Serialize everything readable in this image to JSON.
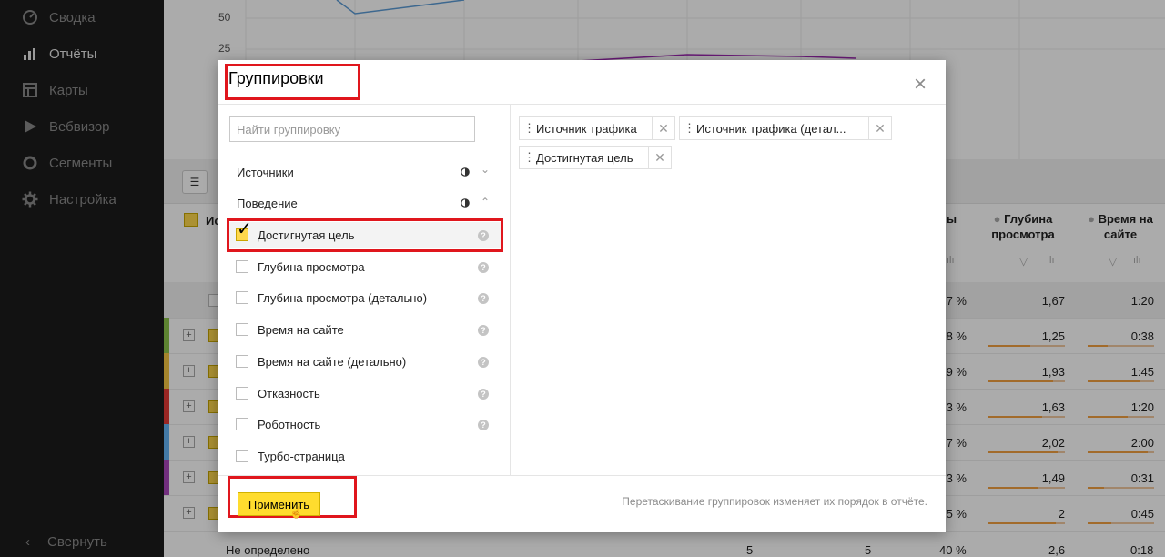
{
  "sidebar": {
    "items": [
      {
        "label": "Сводка",
        "icon": "gauge-icon",
        "active": false
      },
      {
        "label": "Отчёты",
        "icon": "bar-chart-icon",
        "active": true
      },
      {
        "label": "Карты",
        "icon": "map-icon",
        "active": false
      },
      {
        "label": "Вебвизор",
        "icon": "play-icon",
        "active": false
      },
      {
        "label": "Сегменты",
        "icon": "segment-icon",
        "active": false
      },
      {
        "label": "Настройка",
        "icon": "gear-icon",
        "active": false
      }
    ],
    "collapse_label": "Свернуть"
  },
  "report": {
    "chart": {
      "y_ticks": [
        "50",
        "25"
      ]
    },
    "header_truncated": "Ис",
    "columns": {
      "c1_tail": "ы",
      "depth": "Глубина просмотра",
      "time": "Время на сайте"
    },
    "rows": [
      {
        "stripe": "",
        "pct": "7 %",
        "depth": "1,67",
        "time": "1:20",
        "total": true,
        "depth_fill": 0,
        "time_fill": 0
      },
      {
        "stripe": "#8bc34a",
        "pct": "8 %",
        "depth": "1,25",
        "time": "0:38",
        "depth_fill": 0.55,
        "time_fill": 0.3
      },
      {
        "stripe": "#f5c542",
        "pct": "9 %",
        "depth": "1,93",
        "time": "1:45",
        "depth_fill": 0.85,
        "time_fill": 0.8
      },
      {
        "stripe": "#e53935",
        "pct": "3 %",
        "depth": "1,63",
        "time": "1:20",
        "depth_fill": 0.7,
        "time_fill": 0.6
      },
      {
        "stripe": "#64b5f6",
        "pct": "7 %",
        "depth": "2,02",
        "time": "2:00",
        "depth_fill": 0.9,
        "time_fill": 0.9
      },
      {
        "stripe": "#ab47bc",
        "pct": "3 %",
        "depth": "1,49",
        "time": "0:31",
        "depth_fill": 0.65,
        "time_fill": 0.25
      },
      {
        "stripe": "",
        "pct": "5 %",
        "depth": "2",
        "time": "0:45",
        "depth_fill": 0.88,
        "time_fill": 0.35
      }
    ],
    "bottom_row": {
      "label": "Не определено",
      "n1": "5",
      "n2": "5",
      "pct": "40 %",
      "depth": "2,6",
      "time": "0:18"
    }
  },
  "modal": {
    "title": "Группировки",
    "search_placeholder": "Найти группировку",
    "groups": {
      "sources": "Источники",
      "behavior": "Поведение"
    },
    "options": [
      {
        "label": "Достигнутая цель",
        "checked": true
      },
      {
        "label": "Глубина просмотра",
        "checked": false
      },
      {
        "label": "Глубина просмотра (детально)",
        "checked": false
      },
      {
        "label": "Время на сайте",
        "checked": false
      },
      {
        "label": "Время на сайте (детально)",
        "checked": false
      },
      {
        "label": "Отказность",
        "checked": false
      },
      {
        "label": "Роботность",
        "checked": false
      },
      {
        "label": "Турбо-страница",
        "checked": false
      }
    ],
    "chips": [
      "Источник трафика",
      "Источник трафика (детал...",
      "Достигнутая цель"
    ],
    "apply_label": "Применить",
    "hint": "Перетаскивание группировок изменяет их порядок в отчёте."
  },
  "colors": {
    "accent_yellow": "#ffdc2e",
    "highlight_red": "#e0161d"
  }
}
